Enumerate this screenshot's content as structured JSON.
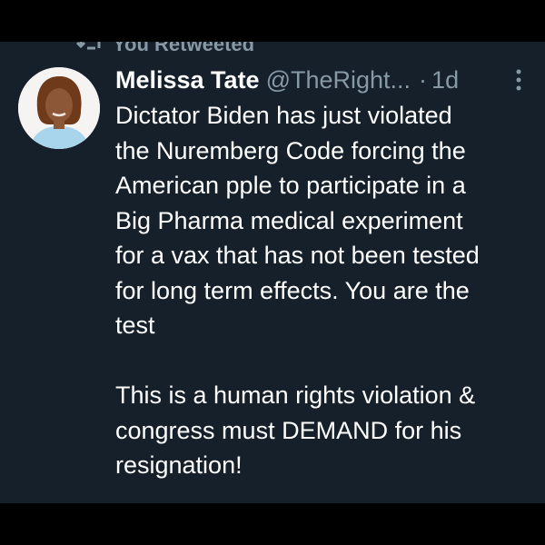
{
  "retweet": {
    "icon": "retweet-icon",
    "label": "You Retweeted"
  },
  "tweet": {
    "author_name": "Melissa Tate",
    "handle": "@TheRight...",
    "separator": "·",
    "time": "1d",
    "more_icon": "more-options-icon",
    "paragraph_1": [
      "Dictator Biden has just violated",
      "the Nuremberg Code forcing the",
      "American pple to participate in a",
      "Big Pharma medical experiment",
      "for a vax that has not been tested",
      "for long term effects. You are the",
      "test"
    ],
    "paragraph_2": [
      "This is a human rights violation &",
      "congress must DEMAND for his",
      "resignation!"
    ]
  },
  "colors": {
    "background": "#15202b",
    "frame": "#000000",
    "text": "#ffffff",
    "muted": "#8899a6"
  }
}
